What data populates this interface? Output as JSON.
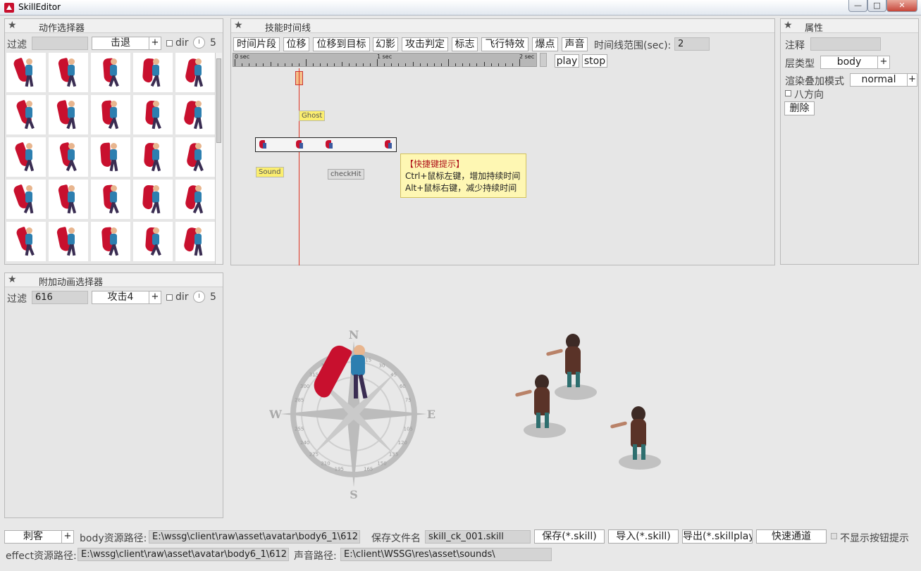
{
  "window": {
    "title": "SkillEditor",
    "min_glyph": "—",
    "max_glyph": "□",
    "close_glyph": "✕"
  },
  "action_selector": {
    "title": "动作选择器",
    "filter_label": "过滤",
    "filter_value": "",
    "combo_value": "击退",
    "plus": "+",
    "dir_label": "dir",
    "count": "5"
  },
  "timeline": {
    "title": "技能时间线",
    "buttons": [
      "时间片段",
      "位移",
      "位移到目标",
      "幻影",
      "攻击判定",
      "标志",
      "飞行特效",
      "爆点",
      "声音"
    ],
    "range_label": "时间线范围(sec):",
    "range_value": "2",
    "ruler_labels": [
      "0 sec",
      "1 sec",
      "2 sec"
    ],
    "play_label": "play",
    "stop_label": "stop",
    "tags": {
      "ghost": "Ghost",
      "sound": "Sound",
      "checkhit": "checkHit"
    },
    "tooltip": {
      "title": "【快捷键提示】",
      "line1": "Ctrl+鼠标左键，增加持续时间",
      "line2": "Alt+鼠标右键，减少持续时间"
    }
  },
  "properties": {
    "title": "属性",
    "note_label": "注释",
    "note_value": "",
    "layer_label": "层类型",
    "layer_value": "body",
    "blend_label": "渲染叠加模式",
    "blend_value": "normal",
    "plus": "+",
    "eight_dir_label": "八方向",
    "delete_label": "删除"
  },
  "extra_selector": {
    "title": "附加动画选择器",
    "filter_label": "过滤",
    "filter_value": "616",
    "combo_value": "攻击4",
    "plus": "+",
    "dir_label": "dir",
    "count": "5"
  },
  "compass": {
    "n": "N",
    "s": "S",
    "e": "E",
    "w": "W",
    "degrees": [
      "315",
      "330",
      "345",
      "15",
      "30",
      "45",
      "60",
      "75",
      "105",
      "120",
      "135",
      "150",
      "165",
      "195",
      "210",
      "225",
      "240",
      "255",
      "285",
      "300"
    ]
  },
  "bottom": {
    "role_value": "刺客",
    "plus": "+",
    "body_path_label": "body资源路径:",
    "body_path_value": "E:\\wssg\\client\\raw\\asset\\avatar\\body6_1\\612",
    "save_file_label": "保存文件名",
    "save_file_value": "skill_ck_001.skill",
    "save_button": "保存(*.skill)",
    "import_button": "导入(*.skill)",
    "export_button": "导出(*.skillplay",
    "quick_button": "快速通道",
    "hide_hint_label": "不显示按钮提示",
    "effect_path_label": "effect资源路径:",
    "effect_path_value": "E:\\wssg\\client\\raw\\asset\\avatar\\body6_1\\612",
    "sound_path_label": "声音路径:",
    "sound_path_value": "E:\\client\\WSSG\\res\\asset\\sounds\\"
  }
}
